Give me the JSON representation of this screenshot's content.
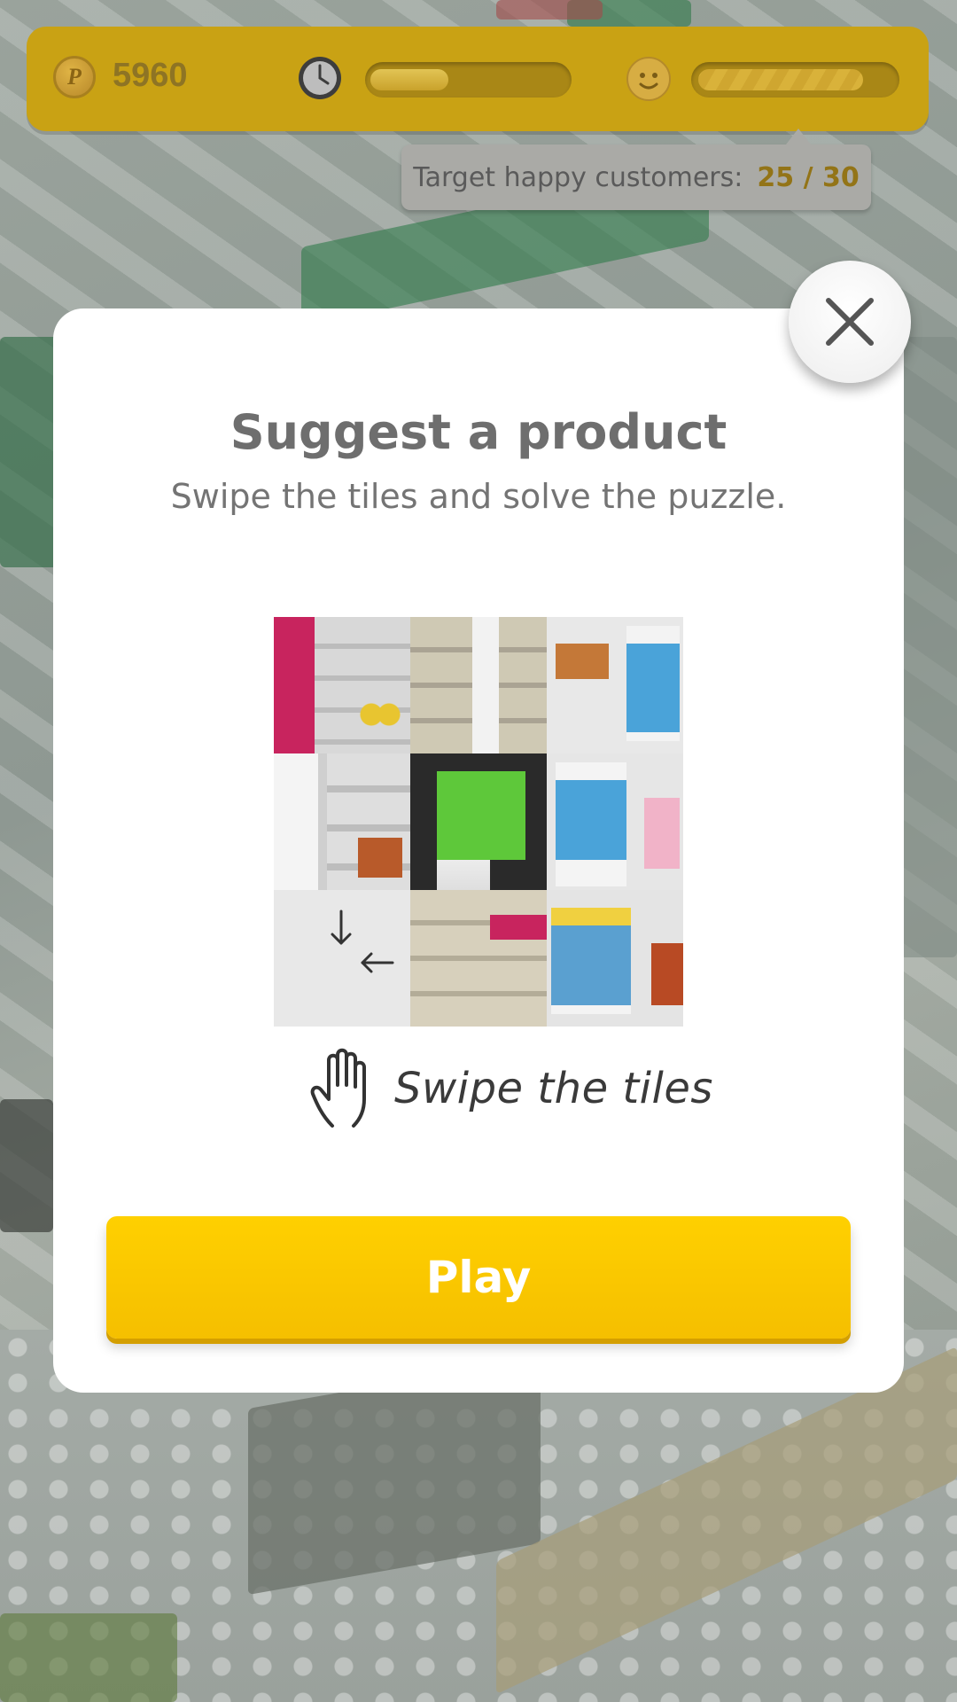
{
  "hud": {
    "coins": "5960",
    "coin_symbol": "P",
    "timer_progress": 0.4,
    "happiness_progress": 0.85
  },
  "target": {
    "label": "Target happy customers:",
    "value": "25 / 30"
  },
  "modal": {
    "title": "Suggest a product",
    "subtitle": "Swipe the tiles and solve the puzzle.",
    "hint": "Swipe the tiles",
    "play_label": "Play"
  },
  "colors": {
    "hud_bg": "#c9a214",
    "play_button": "#ffd000",
    "target_value": "#937417"
  },
  "icons": {
    "coin": "coin-icon",
    "clock": "clock-icon",
    "smiley": "smiley-icon",
    "close": "close-icon",
    "hand": "hand-icon",
    "arrows": "swipe-arrows-icon"
  }
}
